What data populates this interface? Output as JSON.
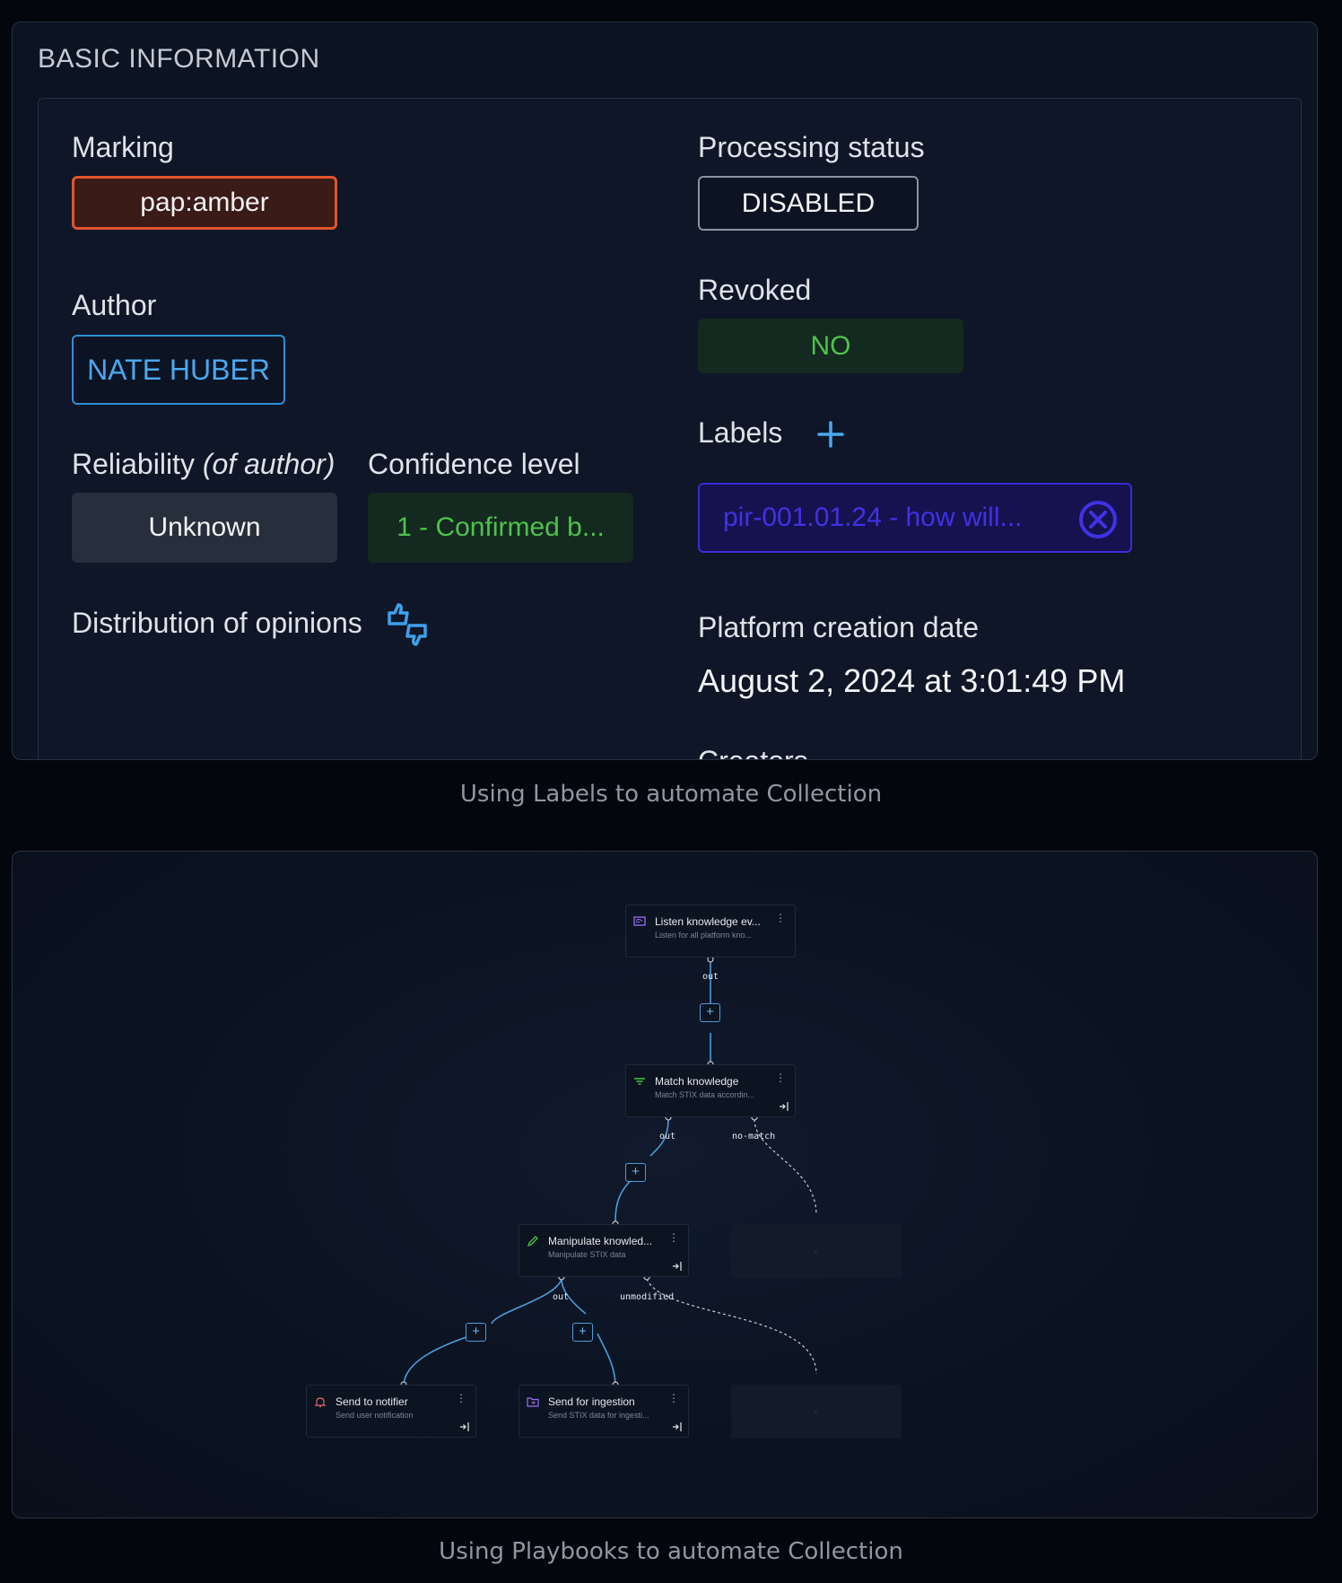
{
  "basic_info": {
    "section_title": "BASIC INFORMATION",
    "marking": {
      "label": "Marking",
      "value": "pap:amber"
    },
    "processing_status": {
      "label": "Processing status",
      "value": "DISABLED"
    },
    "author": {
      "label": "Author",
      "value": "NATE HUBER"
    },
    "revoked": {
      "label": "Revoked",
      "value": "NO"
    },
    "reliability": {
      "label": "Reliability",
      "label_suffix": "(of author)",
      "value": "Unknown"
    },
    "confidence": {
      "label": "Confidence level",
      "value": "1 - Confirmed b..."
    },
    "labels": {
      "label": "Labels",
      "items": [
        "pir-001.01.24 - how will..."
      ]
    },
    "opinions": {
      "label": "Distribution of opinions"
    },
    "creation_date": {
      "label": "Platform creation date",
      "value": "August 2, 2024 at 3:01:49 PM"
    },
    "creators": {
      "label": "Creators"
    }
  },
  "captions": {
    "first": "Using Labels to automate Collection",
    "second": "Using Playbooks to automate Collection"
  },
  "playbook": {
    "nodes": {
      "listen": {
        "title": "Listen knowledge ev...",
        "subtitle": "Listen for all platform kno...",
        "icon": "broadcast-icon"
      },
      "match": {
        "title": "Match knowledge",
        "subtitle": "Match STIX data accordin...",
        "icon": "filter-icon"
      },
      "manipulate": {
        "title": "Manipulate knowled...",
        "subtitle": "Manipulate STIX data",
        "icon": "pencil-icon"
      },
      "notifier": {
        "title": "Send to notifier",
        "subtitle": "Send user notification",
        "icon": "bell-icon"
      },
      "ingestion": {
        "title": "Send for ingestion",
        "subtitle": "Send STIX data for ingesti...",
        "icon": "folder-icon"
      }
    },
    "ports": {
      "listen_out": "out",
      "match_out": "out",
      "match_nomatch": "no-match",
      "manipulate_out": "out",
      "manipulate_unmodified": "unmodified"
    },
    "add_symbol": "+",
    "kebab_symbol": "⋮"
  },
  "colors": {
    "marking_border": "#e0552c",
    "author_accent": "#4aa8f0",
    "revoked_green": "#4ec24d",
    "label_purple": "#3a2cd6",
    "edge_blue": "#4b9ddb"
  }
}
